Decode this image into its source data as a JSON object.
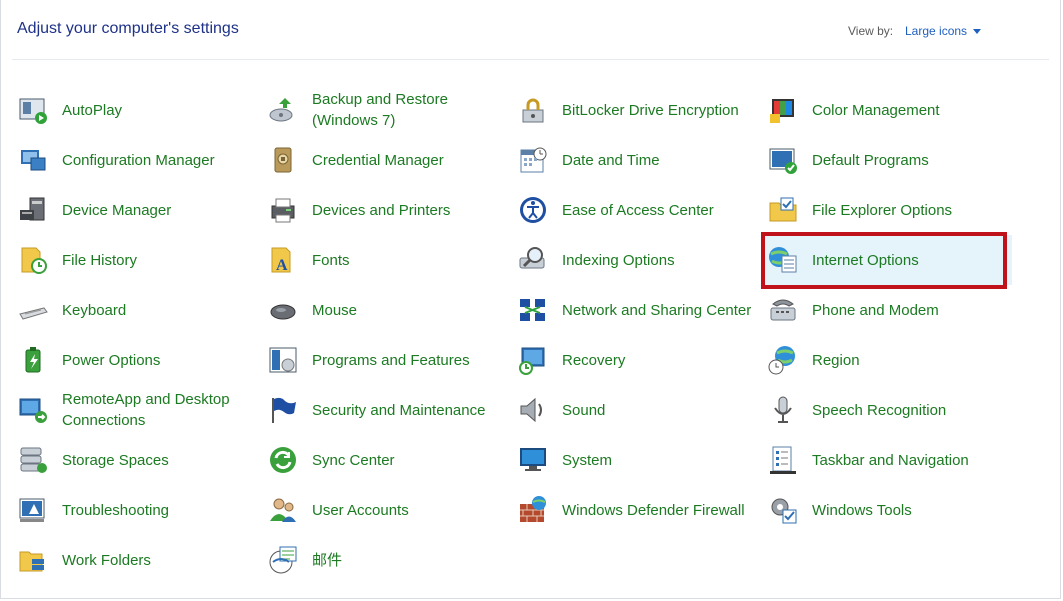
{
  "header": {
    "title": "Adjust your computer's settings",
    "view_by_label": "View by:",
    "view_by_value": "Large icons"
  },
  "accent": {
    "link_green": "#1c7a22",
    "title_blue": "#1e3287",
    "select_blue": "#1e5fbf",
    "highlight_red": "#c0121a"
  },
  "items": [
    {
      "label": "AutoPlay",
      "icon": "autoplay-icon"
    },
    {
      "label": "Backup and Restore (Windows 7)",
      "icon": "backup-restore-icon"
    },
    {
      "label": "BitLocker Drive Encryption",
      "icon": "bitlocker-icon"
    },
    {
      "label": "Color Management",
      "icon": "color-management-icon"
    },
    {
      "label": "Configuration Manager",
      "icon": "configuration-manager-icon"
    },
    {
      "label": "Credential Manager",
      "icon": "credential-manager-icon"
    },
    {
      "label": "Date and Time",
      "icon": "date-time-icon"
    },
    {
      "label": "Default Programs",
      "icon": "default-programs-icon"
    },
    {
      "label": "Device Manager",
      "icon": "device-manager-icon"
    },
    {
      "label": "Devices and Printers",
      "icon": "printer-icon"
    },
    {
      "label": "Ease of Access Center",
      "icon": "ease-of-access-icon"
    },
    {
      "label": "File Explorer Options",
      "icon": "folder-options-icon"
    },
    {
      "label": "File History",
      "icon": "file-history-icon"
    },
    {
      "label": "Fonts",
      "icon": "fonts-icon"
    },
    {
      "label": "Indexing Options",
      "icon": "indexing-icon"
    },
    {
      "label": "Internet Options",
      "icon": "internet-options-icon"
    },
    {
      "label": "Keyboard",
      "icon": "keyboard-icon"
    },
    {
      "label": "Mouse",
      "icon": "mouse-icon"
    },
    {
      "label": "Network and Sharing Center",
      "icon": "network-icon"
    },
    {
      "label": "Phone and Modem",
      "icon": "phone-modem-icon"
    },
    {
      "label": "Power Options",
      "icon": "power-icon"
    },
    {
      "label": "Programs and Features",
      "icon": "programs-features-icon"
    },
    {
      "label": "Recovery",
      "icon": "recovery-icon"
    },
    {
      "label": "Region",
      "icon": "region-icon"
    },
    {
      "label": "RemoteApp and Desktop Connections",
      "icon": "remoteapp-icon"
    },
    {
      "label": "Security and Maintenance",
      "icon": "flag-icon"
    },
    {
      "label": "Sound",
      "icon": "speaker-icon"
    },
    {
      "label": "Speech Recognition",
      "icon": "microphone-icon"
    },
    {
      "label": "Storage Spaces",
      "icon": "storage-spaces-icon"
    },
    {
      "label": "Sync Center",
      "icon": "sync-icon"
    },
    {
      "label": "System",
      "icon": "system-icon"
    },
    {
      "label": "Taskbar and Navigation",
      "icon": "taskbar-icon"
    },
    {
      "label": "Troubleshooting",
      "icon": "troubleshooting-icon"
    },
    {
      "label": "User Accounts",
      "icon": "user-accounts-icon"
    },
    {
      "label": "Windows Defender Firewall",
      "icon": "firewall-icon"
    },
    {
      "label": "Windows Tools",
      "icon": "windows-tools-icon"
    },
    {
      "label": "Work Folders",
      "icon": "work-folders-icon"
    },
    {
      "label": "邮件",
      "icon": "mail-icon"
    }
  ],
  "selected_item": "Internet Options"
}
